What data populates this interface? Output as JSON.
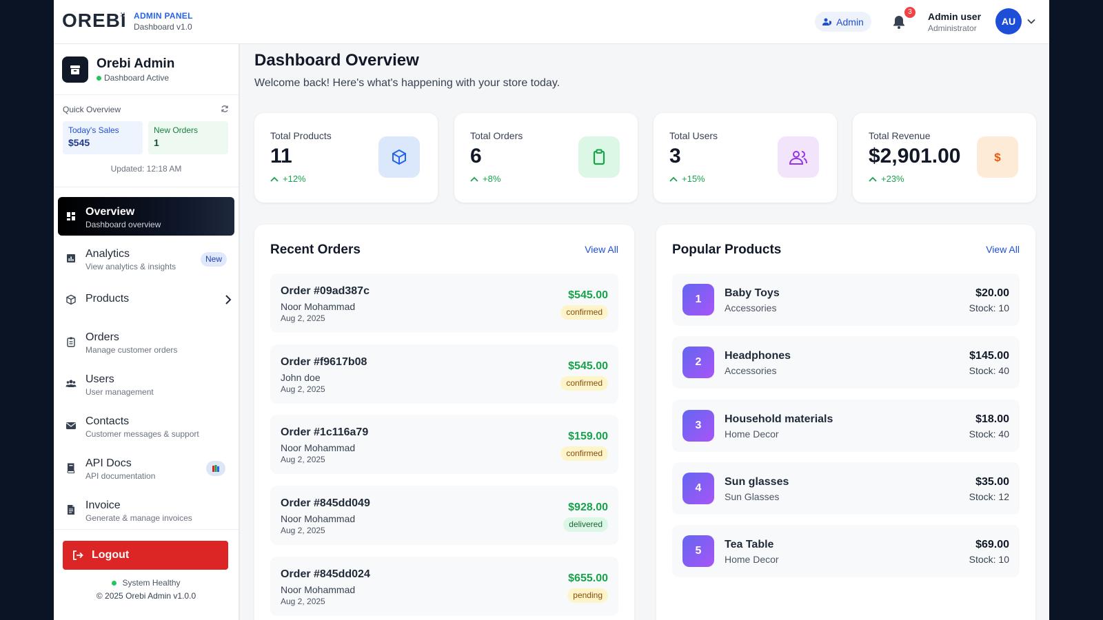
{
  "header": {
    "logo": "OREBI",
    "panel_title": "ADMIN PANEL",
    "panel_subtitle": "Dashboard v1.0",
    "role_pill": "Admin",
    "notification_count": "3",
    "user_name": "Admin user",
    "user_role": "Administrator",
    "avatar_initials": "AU"
  },
  "sidebar": {
    "brand_name": "Orebi Admin",
    "brand_status": "Dashboard Active",
    "quick_overview": {
      "title": "Quick Overview",
      "sales_label": "Today's Sales",
      "sales_value": "$545",
      "orders_label": "New Orders",
      "orders_value": "1",
      "updated": "Updated: 12:18 AM"
    },
    "items": [
      {
        "label": "Overview",
        "desc": "Dashboard overview",
        "icon": "grid-icon",
        "active": true
      },
      {
        "label": "Analytics",
        "desc": "View analytics & insights",
        "icon": "bar-chart-icon",
        "badge": "New"
      },
      {
        "label": "Products",
        "desc": "",
        "icon": "box-icon",
        "expandable": true
      },
      {
        "label": "Orders",
        "desc": "Manage customer orders",
        "icon": "clipboard-icon"
      },
      {
        "label": "Users",
        "desc": "User management",
        "icon": "users-icon"
      },
      {
        "label": "Contacts",
        "desc": "Customer messages & support",
        "icon": "envelope-icon"
      },
      {
        "label": "API Docs",
        "desc": "API documentation",
        "icon": "book-icon",
        "badge_icon": "books-emoji-icon"
      },
      {
        "label": "Invoice",
        "desc": "Generate & manage invoices",
        "icon": "invoice-icon"
      }
    ],
    "logout_label": "Logout",
    "system_status": "System Healthy",
    "copyright": "© 2025 Orebi Admin v1.0.0"
  },
  "main": {
    "title": "Dashboard Overview",
    "subtitle": "Welcome back! Here's what's happening with your store today.",
    "stats": [
      {
        "label": "Total Products",
        "value": "11",
        "change": "+12%",
        "icon": "cube-icon",
        "color": "#2563eb",
        "bg": "#dbe8fb"
      },
      {
        "label": "Total Orders",
        "value": "6",
        "change": "+8%",
        "icon": "clipboard-icon",
        "color": "#16a34a",
        "bg": "#dcf7e5"
      },
      {
        "label": "Total Users",
        "value": "3",
        "change": "+15%",
        "icon": "users-icon",
        "color": "#9333ea",
        "bg": "#f1e4fb"
      },
      {
        "label": "Total Revenue",
        "value": "$2,901.00",
        "change": "+23%",
        "icon": "dollar-icon",
        "color": "#ea580c",
        "bg": "#fdebd7"
      }
    ],
    "recent_orders": {
      "title": "Recent Orders",
      "view_all": "View All",
      "orders": [
        {
          "id": "Order #09ad387c",
          "customer": "Noor Mohammad",
          "date": "Aug 2, 2025",
          "amount": "$545.00",
          "status": "confirmed"
        },
        {
          "id": "Order #f9617b08",
          "customer": "John doe",
          "date": "Aug 2, 2025",
          "amount": "$545.00",
          "status": "confirmed"
        },
        {
          "id": "Order #1c116a79",
          "customer": "Noor Mohammad",
          "date": "Aug 2, 2025",
          "amount": "$159.00",
          "status": "confirmed"
        },
        {
          "id": "Order #845dd049",
          "customer": "Noor Mohammad",
          "date": "Aug 2, 2025",
          "amount": "$928.00",
          "status": "delivered"
        },
        {
          "id": "Order #845dd024",
          "customer": "Noor Mohammad",
          "date": "Aug 2, 2025",
          "amount": "$655.00",
          "status": "pending"
        }
      ]
    },
    "popular_products": {
      "title": "Popular Products",
      "view_all": "View All",
      "products": [
        {
          "rank": "1",
          "name": "Baby Toys",
          "category": "Accessories",
          "price": "$20.00",
          "stock": "Stock: 10"
        },
        {
          "rank": "2",
          "name": "Headphones",
          "category": "Accessories",
          "price": "$145.00",
          "stock": "Stock: 40"
        },
        {
          "rank": "3",
          "name": "Household materials",
          "category": "Home Decor",
          "price": "$18.00",
          "stock": "Stock: 40"
        },
        {
          "rank": "4",
          "name": "Sun glasses",
          "category": "Sun Glasses",
          "price": "$35.00",
          "stock": "Stock: 12"
        },
        {
          "rank": "5",
          "name": "Tea Table",
          "category": "Home Decor",
          "price": "$69.00",
          "stock": "Stock: 10"
        }
      ]
    }
  }
}
